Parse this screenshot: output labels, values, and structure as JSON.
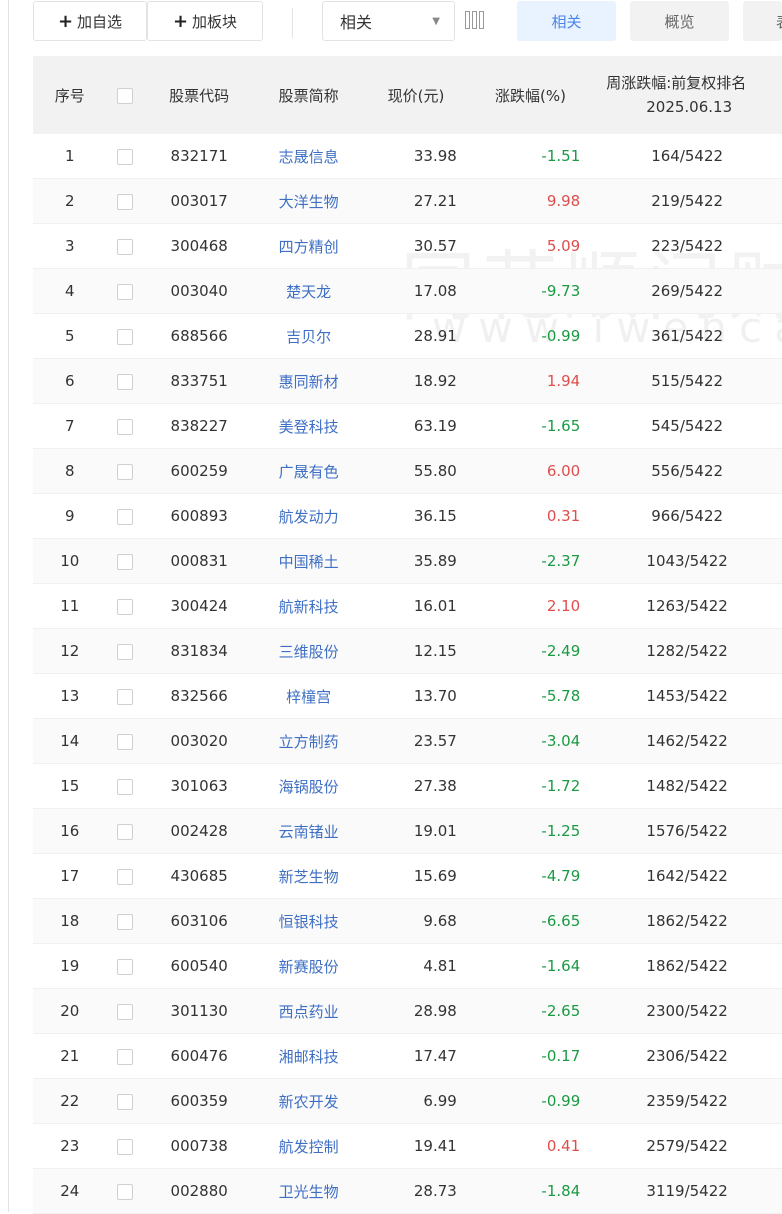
{
  "toolbar": {
    "add_watchlist": "加自选",
    "add_sector": "加板块",
    "select_value": "相关",
    "tabs": [
      "相关",
      "概览",
      "表"
    ]
  },
  "table": {
    "headers": {
      "index": "序号",
      "code": "股票代码",
      "name": "股票简称",
      "price": "现价(元)",
      "change": "涨跌幅(%)",
      "rank_line1": "周涨跌幅:前复权排名",
      "rank_line2": "2025.06.13"
    },
    "rows": [
      {
        "idx": "1",
        "code": "832171",
        "name": "志晟信息",
        "price": "33.98",
        "change": "-1.51",
        "rank": "164/5422"
      },
      {
        "idx": "2",
        "code": "003017",
        "name": "大洋生物",
        "price": "27.21",
        "change": "9.98",
        "rank": "219/5422"
      },
      {
        "idx": "3",
        "code": "300468",
        "name": "四方精创",
        "price": "30.57",
        "change": "5.09",
        "rank": "223/5422"
      },
      {
        "idx": "4",
        "code": "003040",
        "name": "楚天龙",
        "price": "17.08",
        "change": "-9.73",
        "rank": "269/5422"
      },
      {
        "idx": "5",
        "code": "688566",
        "name": "吉贝尔",
        "price": "28.91",
        "change": "-0.99",
        "rank": "361/5422"
      },
      {
        "idx": "6",
        "code": "833751",
        "name": "惠同新材",
        "price": "18.92",
        "change": "1.94",
        "rank": "515/5422"
      },
      {
        "idx": "7",
        "code": "838227",
        "name": "美登科技",
        "price": "63.19",
        "change": "-1.65",
        "rank": "545/5422"
      },
      {
        "idx": "8",
        "code": "600259",
        "name": "广晟有色",
        "price": "55.80",
        "change": "6.00",
        "rank": "556/5422"
      },
      {
        "idx": "9",
        "code": "600893",
        "name": "航发动力",
        "price": "36.15",
        "change": "0.31",
        "rank": "966/5422"
      },
      {
        "idx": "10",
        "code": "000831",
        "name": "中国稀土",
        "price": "35.89",
        "change": "-2.37",
        "rank": "1043/5422"
      },
      {
        "idx": "11",
        "code": "300424",
        "name": "航新科技",
        "price": "16.01",
        "change": "2.10",
        "rank": "1263/5422"
      },
      {
        "idx": "12",
        "code": "831834",
        "name": "三维股份",
        "price": "12.15",
        "change": "-2.49",
        "rank": "1282/5422"
      },
      {
        "idx": "13",
        "code": "832566",
        "name": "梓橦宫",
        "price": "13.70",
        "change": "-5.78",
        "rank": "1453/5422"
      },
      {
        "idx": "14",
        "code": "003020",
        "name": "立方制药",
        "price": "23.57",
        "change": "-3.04",
        "rank": "1462/5422"
      },
      {
        "idx": "15",
        "code": "301063",
        "name": "海锅股份",
        "price": "27.38",
        "change": "-1.72",
        "rank": "1482/5422"
      },
      {
        "idx": "16",
        "code": "002428",
        "name": "云南锗业",
        "price": "19.01",
        "change": "-1.25",
        "rank": "1576/5422"
      },
      {
        "idx": "17",
        "code": "430685",
        "name": "新芝生物",
        "price": "15.69",
        "change": "-4.79",
        "rank": "1642/5422"
      },
      {
        "idx": "18",
        "code": "603106",
        "name": "恒银科技",
        "price": "9.68",
        "change": "-6.65",
        "rank": "1862/5422"
      },
      {
        "idx": "19",
        "code": "600540",
        "name": "新赛股份",
        "price": "4.81",
        "change": "-1.64",
        "rank": "1862/5422"
      },
      {
        "idx": "20",
        "code": "301130",
        "name": "西点药业",
        "price": "28.98",
        "change": "-2.65",
        "rank": "2300/5422"
      },
      {
        "idx": "21",
        "code": "600476",
        "name": "湘邮科技",
        "price": "17.47",
        "change": "-0.17",
        "rank": "2306/5422"
      },
      {
        "idx": "22",
        "code": "600359",
        "name": "新农开发",
        "price": "6.99",
        "change": "-0.99",
        "rank": "2359/5422"
      },
      {
        "idx": "23",
        "code": "000738",
        "name": "航发控制",
        "price": "19.41",
        "change": "0.41",
        "rank": "2579/5422"
      },
      {
        "idx": "24",
        "code": "002880",
        "name": "卫光生物",
        "price": "28.73",
        "change": "-1.84",
        "rank": "3119/5422"
      }
    ]
  },
  "watermark": {
    "brand": "同花顺问财",
    "url": "www.iwencai.com"
  },
  "colors": {
    "up": "#e04d4d",
    "down": "#1a9a43",
    "link": "#3e6fc4",
    "accent": "#4a86e8"
  }
}
